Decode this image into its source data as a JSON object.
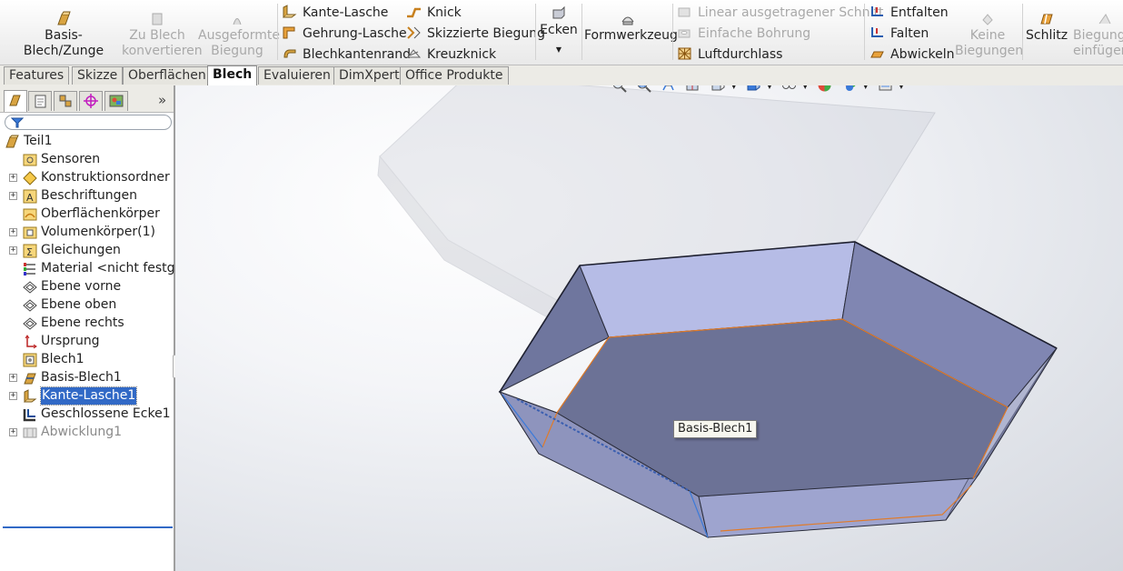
{
  "ribbon": {
    "basis_blech": "Basis-Blech/Zunge",
    "zu_blech": "Zu Blech\nkonvertieren",
    "ausgeformte": "Ausgeformte\nBiegung",
    "kante_lasche": "Kante-Lasche",
    "gehrung_lasche": "Gehrung-Lasche",
    "blechkantenrand": "Blechkantenrand",
    "knick": "Knick",
    "skizzierte_biegung": "Skizzierte Biegung",
    "kreuzknick": "Kreuzknick",
    "ecken": "Ecken",
    "formwerkzeug": "Formwerkzeug",
    "linear_schnitt": "Linear ausgetragener Schnitt",
    "einfache_bohrung": "Einfache Bohrung",
    "luftdurchlass": "Luftdurchlass",
    "entfalten": "Entfalten",
    "falten": "Falten",
    "abwickeln": "Abwickeln",
    "keine_biegungen": "Keine\nBiegungen",
    "schlitz": "Schlitz",
    "biegung_einfuegen": "Biegungen\neinfügen"
  },
  "tabs": [
    "Features",
    "Skizze",
    "Oberflächen",
    "Blech",
    "Evaluieren",
    "DimXpert",
    "Office Produkte"
  ],
  "active_tab": "Blech",
  "tree": {
    "root": "Teil1",
    "items": [
      {
        "label": "Sensoren",
        "expandable": false
      },
      {
        "label": "Konstruktionsordner",
        "expandable": true
      },
      {
        "label": "Beschriftungen",
        "expandable": true
      },
      {
        "label": "Oberflächenkörper",
        "expandable": false
      },
      {
        "label": "Volumenkörper(1)",
        "expandable": true
      },
      {
        "label": "Gleichungen",
        "expandable": true
      },
      {
        "label": "Material <nicht festgelegt>",
        "expandable": false
      },
      {
        "label": "Ebene vorne",
        "expandable": false
      },
      {
        "label": "Ebene oben",
        "expandable": false
      },
      {
        "label": "Ebene rechts",
        "expandable": false
      },
      {
        "label": "Ursprung",
        "expandable": false
      },
      {
        "label": "Blech1",
        "expandable": false
      },
      {
        "label": "Basis-Blech1",
        "expandable": true
      },
      {
        "label": "Kante-Lasche1",
        "expandable": true
      },
      {
        "label": "Geschlossene Ecke1",
        "expandable": false
      },
      {
        "label": "Abwicklung1",
        "expandable": true
      }
    ]
  },
  "viewport": {
    "tooltip": "Basis-Blech1"
  },
  "colors": {
    "selection": "#3169c6",
    "part_face": "#7f86ad",
    "part_light": "#b3b9e3",
    "edge_highlight": "#e07b2a"
  }
}
